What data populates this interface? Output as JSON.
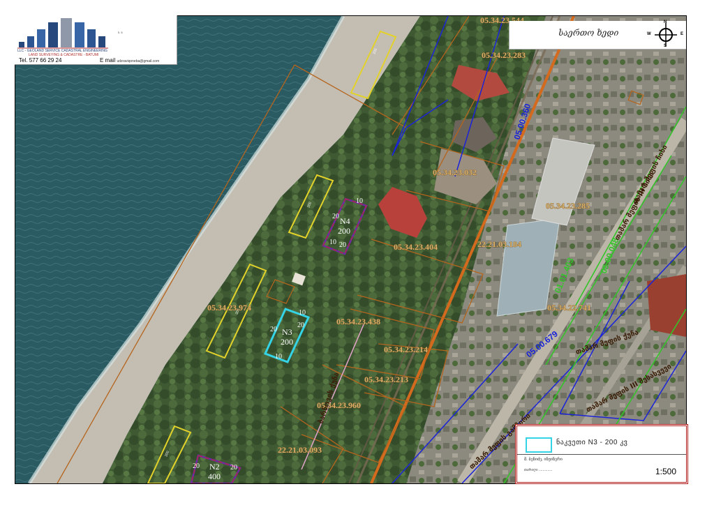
{
  "header": {
    "company_name": "LLC - GEOLAND SERVICE CADASTRAL ENGINEERING",
    "company_sub": "LAND SURVEYING & CADASTRE - BATUMI",
    "tel_label": "Tel.",
    "tel_value": "577 66 29 24",
    "email_label": "E mail",
    "email_value": "udzraviqoneba@gmail.com",
    "logo_small": "ს. 5"
  },
  "compass": {
    "title": "საერთო ხედი",
    "n": "N",
    "s": "S",
    "e": "E",
    "w": "W"
  },
  "parcels": [
    {
      "id": "05.34.23.544"
    },
    {
      "id": "05.34.23.283"
    },
    {
      "id": "05.34.23.032"
    },
    {
      "id": "05.34.23.285"
    },
    {
      "id": "05.34.23.404"
    },
    {
      "id": "22.21.03.184"
    },
    {
      "id": "05.34.23.974"
    },
    {
      "id": "05.34.23.438"
    },
    {
      "id": "05.34.22.741"
    },
    {
      "id": "05.34.23.214"
    },
    {
      "id": "05.34.23.213"
    },
    {
      "id": "05.34.23.960"
    },
    {
      "id": "22.21.03.093"
    }
  ],
  "blue_labels": [
    "05.00.360",
    "05.00.679"
  ],
  "green_labels": [
    "01.01.403",
    "05.00.048"
  ],
  "plots": [
    {
      "name": "N4",
      "area": "200",
      "dims": [
        "10",
        "20",
        "10",
        "20"
      ]
    },
    {
      "name": "N3",
      "area": "200",
      "dims": [
        "10",
        "20",
        "10",
        "20"
      ]
    },
    {
      "name": "N2",
      "area": "400",
      "dims": [
        "20",
        "20"
      ]
    }
  ],
  "streets": [
    "თამარ მეფის III ჩიხი",
    "თამარ მეფის III შესახვევი",
    "თამარ მეფის გამზირი",
    "თამარ მეფის ჩიხი",
    "თამარ მეფის ქუჩა",
    "ბარნოვის ქუჩა"
  ],
  "small_box_label": "200",
  "legend": {
    "item_label": "ნაკვეთი N3 - 200 კვ",
    "author": "მ. ბენიძე, ინჟინერი",
    "date": "თარიღი ..............",
    "scale": "1:500"
  },
  "colors": {
    "sea": "#2a5b63",
    "beach": "#bdb7ad",
    "parcel_line": "#b5651d",
    "blue_line": "#1a23d8",
    "green_line": "#33c52a",
    "plot_n3": "#35d3e6",
    "plot_purple": "#6b2aa6",
    "yellow_box": "#e3d22a",
    "rail": "#d46a1e"
  }
}
